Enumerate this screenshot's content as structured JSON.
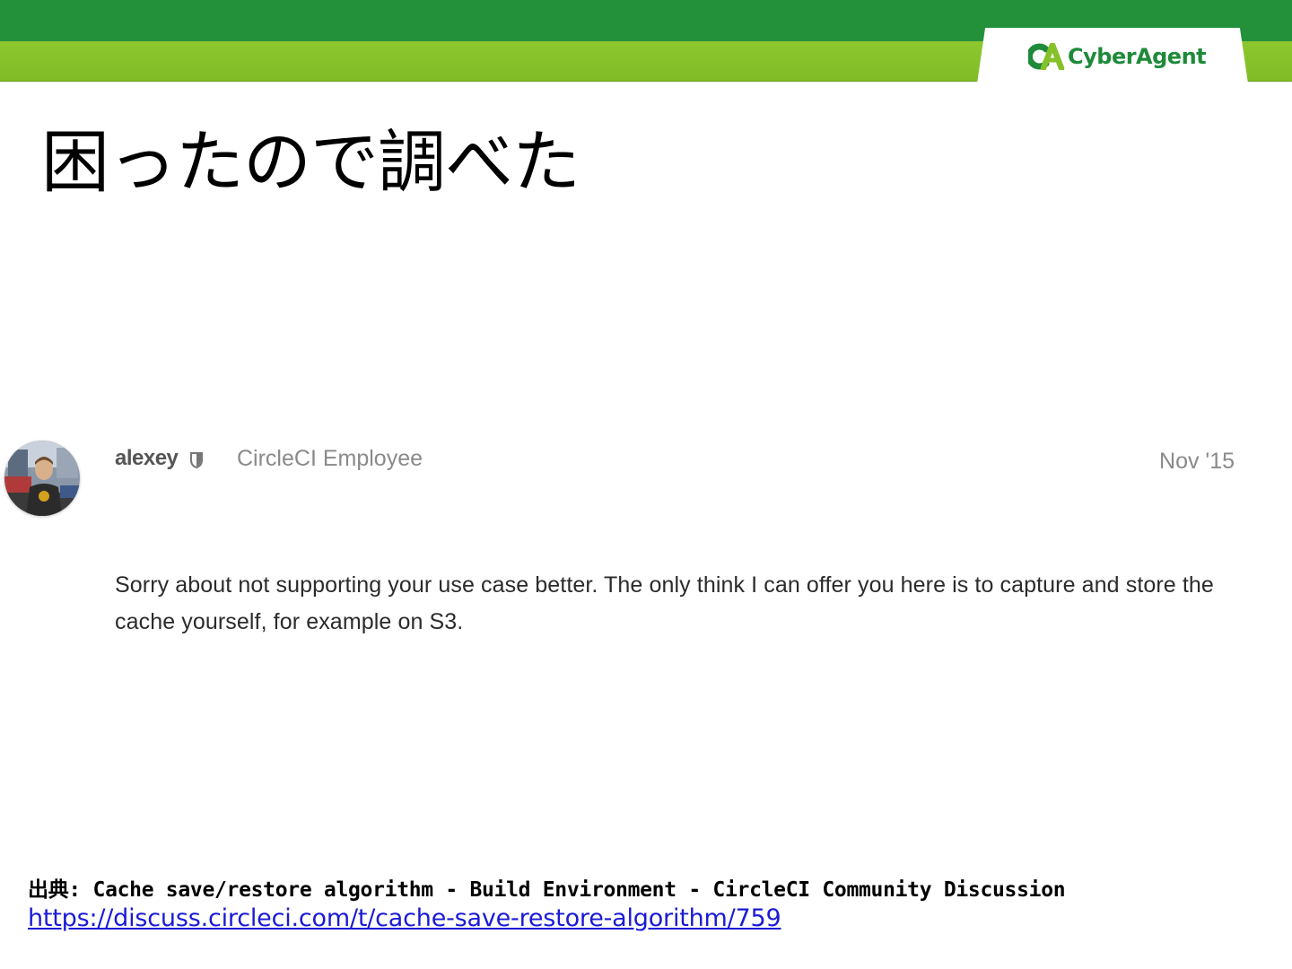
{
  "header": {
    "logo_text": "CyberAgent",
    "colors": {
      "band_dark": "#23913a",
      "band_light": "#86c12a",
      "logo_green": "#1f8a3a"
    }
  },
  "slide": {
    "title": "困ったので調べた"
  },
  "post": {
    "username": "alexey",
    "user_title": "CircleCI Employee",
    "date": "Nov '15",
    "body": "Sorry about not supporting your use case better. The only think I can offer you here is to capture and store the cache yourself, for example on S3.",
    "icons": {
      "avatar": "user-avatar",
      "badge": "shield-icon"
    }
  },
  "source": {
    "label": "出典",
    "separator": ": ",
    "text": "Cache save/restore algorithm - Build Environment - CircleCI Community Discussion",
    "url": "https://discuss.circleci.com/t/cache-save-restore-algorithm/759"
  }
}
